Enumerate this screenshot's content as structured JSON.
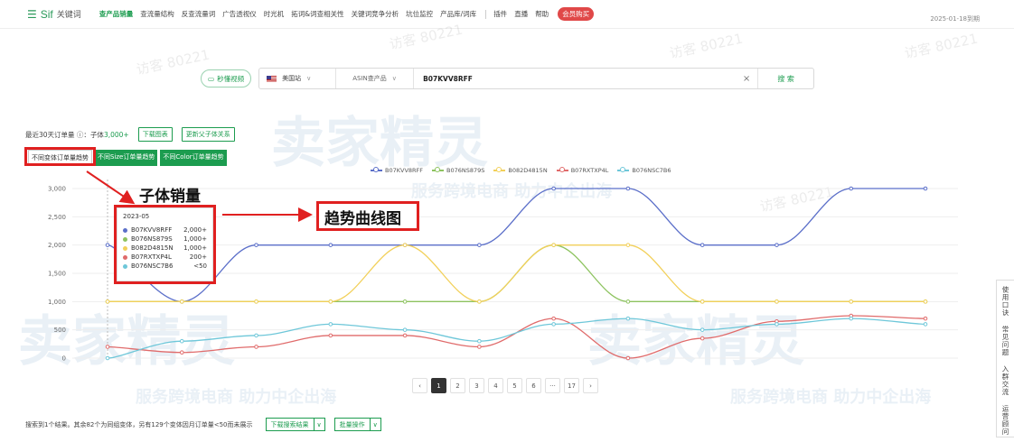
{
  "nav": {
    "brand": "Sif",
    "brand_sub": "关键词",
    "items": [
      "查产品销量",
      "查流量结构",
      "反查流量词",
      "广告透视仪",
      "时光机",
      "拓词&词查相关性",
      "关键词竞争分析",
      "坑位监控",
      "产品库/词库"
    ],
    "right_items": [
      "插件",
      "直播",
      "帮助"
    ],
    "vip": "会员购买",
    "date": "2025-01-18到期"
  },
  "search": {
    "video_btn": "秒懂视频",
    "site": "美国站",
    "type": "ASIN查产品",
    "query": "B07KVV8RFF",
    "clear": "×",
    "submit": "搜 索"
  },
  "summary": {
    "label": "最近30天订单量 ⓘ：",
    "value_prefix": "子体",
    "value": "3,000+",
    "download_btn": "下载图表",
    "update_btn": "更新父子体关系"
  },
  "tabs": [
    "不同变体订单量趋势",
    "不同Size订单量趋势",
    "不同Color订单量趋势"
  ],
  "chart_data": {
    "type": "line",
    "series": [
      {
        "name": "B07KVV8RFF",
        "color": "#5b6fc9",
        "values": [
          2000,
          1000,
          2000,
          2000,
          2000,
          2000,
          3000,
          3000,
          2000,
          2000,
          3000,
          3000
        ]
      },
      {
        "name": "B076NS879S",
        "color": "#8dc35f",
        "values": [
          1000,
          1000,
          1000,
          1000,
          1000,
          1000,
          2000,
          1000,
          1000,
          1000,
          1000,
          1000
        ]
      },
      {
        "name": "B082D4815N",
        "color": "#f2d05a",
        "values": [
          1000,
          1000,
          1000,
          1000,
          2000,
          1000,
          2000,
          2000,
          1000,
          1000,
          1000,
          1000
        ]
      },
      {
        "name": "B07RXTXP4L",
        "color": "#e06b6b",
        "values": [
          200,
          100,
          200,
          400,
          400,
          200,
          700,
          0,
          350,
          650,
          750,
          700
        ]
      },
      {
        "name": "B076NSC7B6",
        "color": "#6ec7d9",
        "values": [
          0,
          300,
          400,
          600,
          500,
          300,
          600,
          700,
          500,
          600,
          700,
          600
        ]
      }
    ],
    "yticks": [
      "3,000",
      "2,500",
      "2,000",
      "1,500",
      "1,000",
      "500",
      "0"
    ],
    "ylim": [
      0,
      3000
    ]
  },
  "tooltip": {
    "title": "2023-05",
    "rows": [
      {
        "name": "B07KVV8RFF",
        "value": "2,000+",
        "color": "#5b6fc9"
      },
      {
        "name": "B076NS879S",
        "value": "1,000+",
        "color": "#8dc35f"
      },
      {
        "name": "B082D4815N",
        "value": "1,000+",
        "color": "#f2d05a"
      },
      {
        "name": "B07RXTXP4L",
        "value": "200+",
        "color": "#e06b6b"
      },
      {
        "name": "B076NSC7B6",
        "value": "<50",
        "color": "#6ec7d9"
      }
    ]
  },
  "annotations": {
    "child_sales": "子体销量",
    "trend_chart": "趋势曲线图"
  },
  "pager": [
    "‹",
    "1",
    "2",
    "3",
    "4",
    "5",
    "6",
    "···",
    "17",
    "›"
  ],
  "footer": {
    "text": "搜索到1个结果。其余82个为同组变体，另有129个变体因月订单量<50而未展示",
    "download_btn": "下载搜索结果",
    "batch_btn": "批量操作",
    "dropdown": "∨"
  },
  "side": [
    "使用口诀",
    "常见问题",
    "入群交流",
    "运营顾问"
  ],
  "watermarks": {
    "brand_cn": "卖家精灵",
    "slogan": "服务跨境电商 助力中企出海",
    "faint": "访客 80221"
  }
}
